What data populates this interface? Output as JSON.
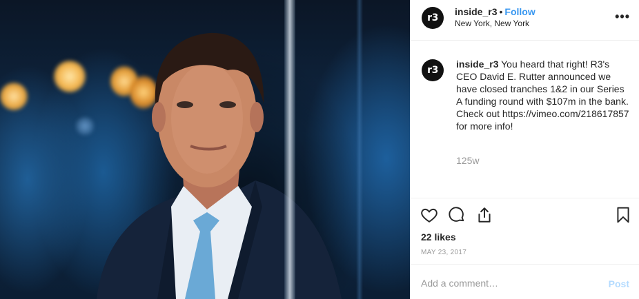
{
  "post": {
    "photo_icon": "portrait-photo",
    "header": {
      "avatar_text": "r3",
      "username": "inside_r3",
      "separator": "•",
      "follow_label": "Follow",
      "location": "New York, New York",
      "more_icon": "ellipsis-icon",
      "more_glyph": "•••"
    },
    "caption": {
      "username": "inside_r3",
      "text": "You heard that right! R3's CEO David E. Rutter announced we have closed tranches 1&2 in our Series A funding round with $107m in the bank. Check out https://vimeo.com/218617857 for more info!",
      "age": "125w"
    },
    "actions": {
      "like_icon": "heart-icon",
      "comment_icon": "comment-icon",
      "share_icon": "share-icon",
      "save_icon": "bookmark-icon"
    },
    "likes": "22 likes",
    "date": "MAY 23, 2017",
    "comment": {
      "placeholder": "Add a comment…",
      "value": "",
      "post_label": "Post"
    },
    "colors": {
      "accent": "#3897f0",
      "post_disabled": "#b3dbff",
      "muted": "#999999",
      "text": "#262626"
    }
  }
}
